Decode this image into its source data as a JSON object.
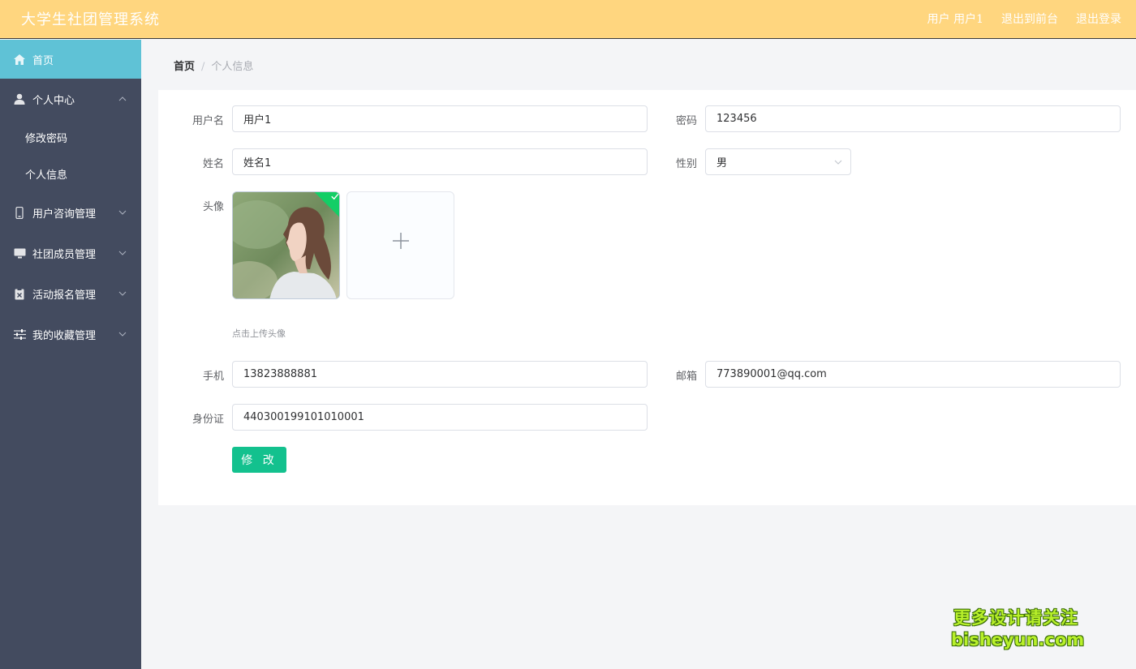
{
  "header": {
    "title": "大学生社团管理系统",
    "user_label": "用户 用户1",
    "back_to_front": "退出到前台",
    "logout": "退出登录"
  },
  "sidebar": {
    "items": [
      {
        "label": "首页",
        "icon": "home-icon",
        "active": true
      },
      {
        "label": "个人中心",
        "icon": "user-icon",
        "expanded": true,
        "children": [
          "修改密码",
          "个人信息"
        ]
      },
      {
        "label": "用户咨询管理",
        "icon": "phone-icon"
      },
      {
        "label": "社团成员管理",
        "icon": "monitor-icon"
      },
      {
        "label": "活动报名管理",
        "icon": "clipboard-icon"
      },
      {
        "label": "我的收藏管理",
        "icon": "sliders-icon"
      }
    ]
  },
  "breadcrumb": {
    "home": "首页",
    "separator": "/",
    "current": "个人信息"
  },
  "form": {
    "username": {
      "label": "用户名",
      "value": "用户1"
    },
    "password": {
      "label": "密码",
      "value": "123456"
    },
    "name": {
      "label": "姓名",
      "value": "姓名1"
    },
    "gender": {
      "label": "性别",
      "value": "男"
    },
    "avatar": {
      "label": "头像",
      "tip": "点击上传头像",
      "upload_glyph": "+"
    },
    "phone": {
      "label": "手机",
      "value": "13823888881"
    },
    "email": {
      "label": "邮箱",
      "value": "773890001@qq.com"
    },
    "id_card": {
      "label": "身份证",
      "value": "440300199101010001"
    },
    "submit_label": "修 改"
  },
  "watermark": {
    "line1": "更多设计请关注",
    "line2": "bisheyun.com"
  },
  "colors": {
    "header_bg": "#ffd67f",
    "sidebar_bg": "#434b5f",
    "active_item": "#5fc2d6",
    "primary_button": "#13c18e",
    "success_badge": "#13ce66"
  }
}
